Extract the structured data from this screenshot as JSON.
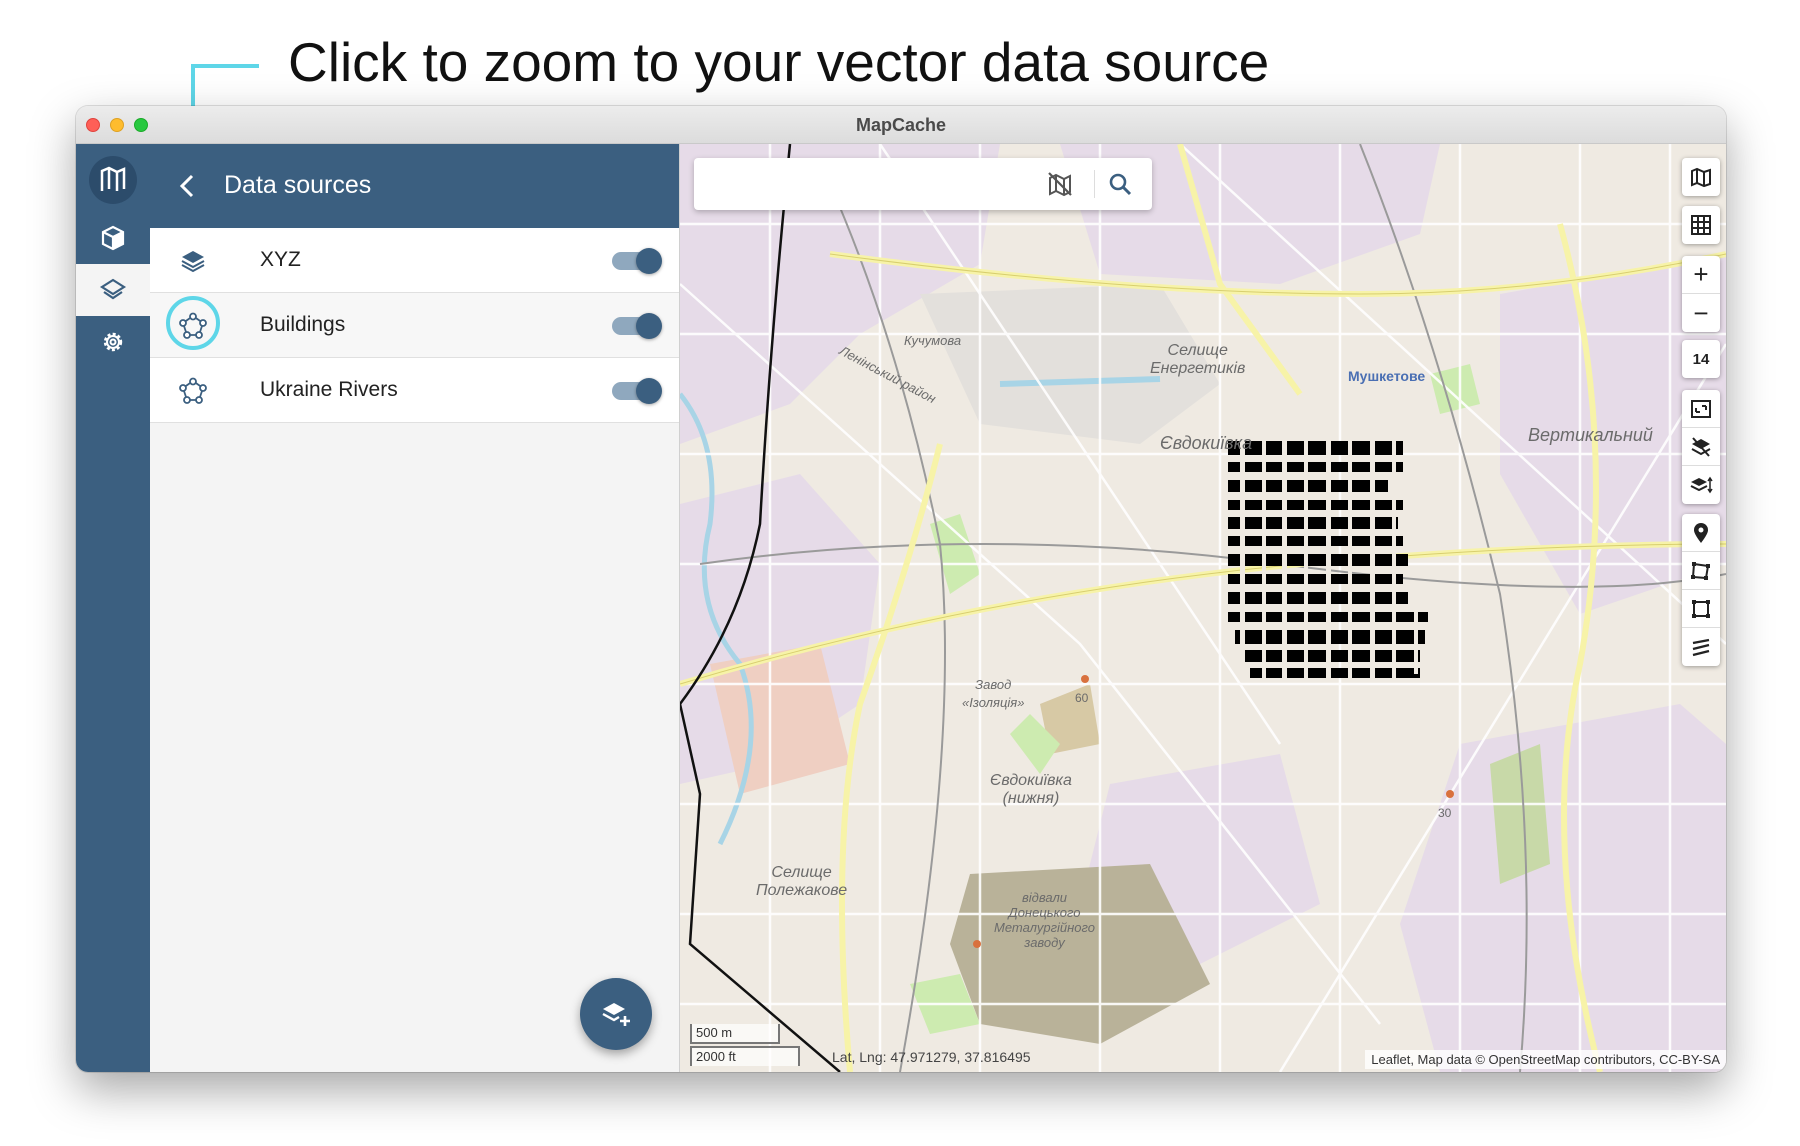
{
  "callout": {
    "text": "Click to zoom to your vector data source"
  },
  "window": {
    "title": "MapCache"
  },
  "nav_rail": {
    "items": [
      {
        "name": "projects",
        "icon": "cube-icon"
      },
      {
        "name": "layers",
        "icon": "layers-icon"
      },
      {
        "name": "settings",
        "icon": "gear-icon"
      }
    ]
  },
  "panel": {
    "title": "Data sources",
    "sources": [
      {
        "label": "XYZ",
        "icon": "tile-layers-icon",
        "enabled": true
      },
      {
        "label": "Buildings",
        "icon": "vector-polygon-icon",
        "enabled": true
      },
      {
        "label": "Ukraine Rivers",
        "icon": "vector-polygon-icon",
        "enabled": true
      }
    ],
    "fab_icon": "add-layer-icon"
  },
  "map": {
    "zoom_level": "14",
    "scale_metric": "500 m",
    "scale_imperial": "2000 ft",
    "coordinates": "Lat, Lng: 47.971279, 37.816495",
    "attribution": "Leaflet, Map data © OpenStreetMap contributors, CC-BY-SA",
    "place_labels": {
      "evdokiivka": "Євдокиївка",
      "energetikiv_1": "Селище",
      "energetikiv_2": "Енергетиків",
      "mushketove": "Мушкетове",
      "vertykalnyi": "Вертикальний",
      "kuchumova": "Кучумова",
      "lenin_district": "Ленінський район",
      "zavod_1": "Завод",
      "zavod_2": "«Ізоляція»",
      "lower_1": "Євдокиївка",
      "lower_2": "(нижня)",
      "polezhakove_1": "Селище",
      "polezhakove_2": "Полежакове",
      "dumps_1": "відвали",
      "dumps_2": "Донецького",
      "dumps_3": "Металургійного",
      "dumps_4": "заводу",
      "hill_60": "60",
      "hill_30": "30"
    },
    "colors": {
      "residential": "#e6dbe8",
      "road_major": "#f7f3a8",
      "park": "#cdebb0",
      "water": "#a8d4e6",
      "buildings": "#000000"
    }
  }
}
